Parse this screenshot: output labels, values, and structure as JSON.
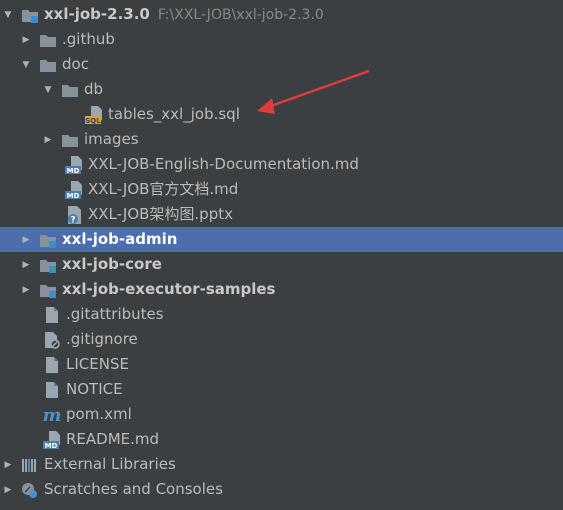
{
  "tree": {
    "root": {
      "label": "xxl-job-2.3.0",
      "path": "F:\\XXL-JOB\\xxl-job-2.3.0"
    },
    "github": {
      "label": ".github"
    },
    "doc": {
      "label": "doc"
    },
    "db": {
      "label": "db"
    },
    "tables_sql": {
      "label": "tables_xxl_job.sql",
      "icon_text": "SQL"
    },
    "images": {
      "label": "images"
    },
    "doc_en": {
      "label": "XXL-JOB-English-Documentation.md",
      "icon_text": "MD"
    },
    "doc_cn": {
      "label": "XXL-JOB官方文档.md",
      "icon_text": "MD"
    },
    "arch_pptx": {
      "label": "XXL-JOB架构图.pptx"
    },
    "admin": {
      "label": "xxl-job-admin"
    },
    "core": {
      "label": "xxl-job-core"
    },
    "executor": {
      "label": "xxl-job-executor-samples"
    },
    "gitattributes": {
      "label": ".gitattributes"
    },
    "gitignore": {
      "label": ".gitignore"
    },
    "license": {
      "label": "LICENSE"
    },
    "notice": {
      "label": "NOTICE"
    },
    "pom": {
      "label": "pom.xml"
    },
    "readme": {
      "label": "README.md",
      "icon_text": "MD"
    },
    "ext_libs": {
      "label": "External Libraries"
    },
    "scratches": {
      "label": "Scratches and Consoles"
    }
  },
  "colors": {
    "background": "#3c3f41",
    "selection": "#4b6eaf",
    "folder": "#87939a",
    "module_badge": "#3592c4",
    "annotation_arrow": "#e03c3c"
  }
}
